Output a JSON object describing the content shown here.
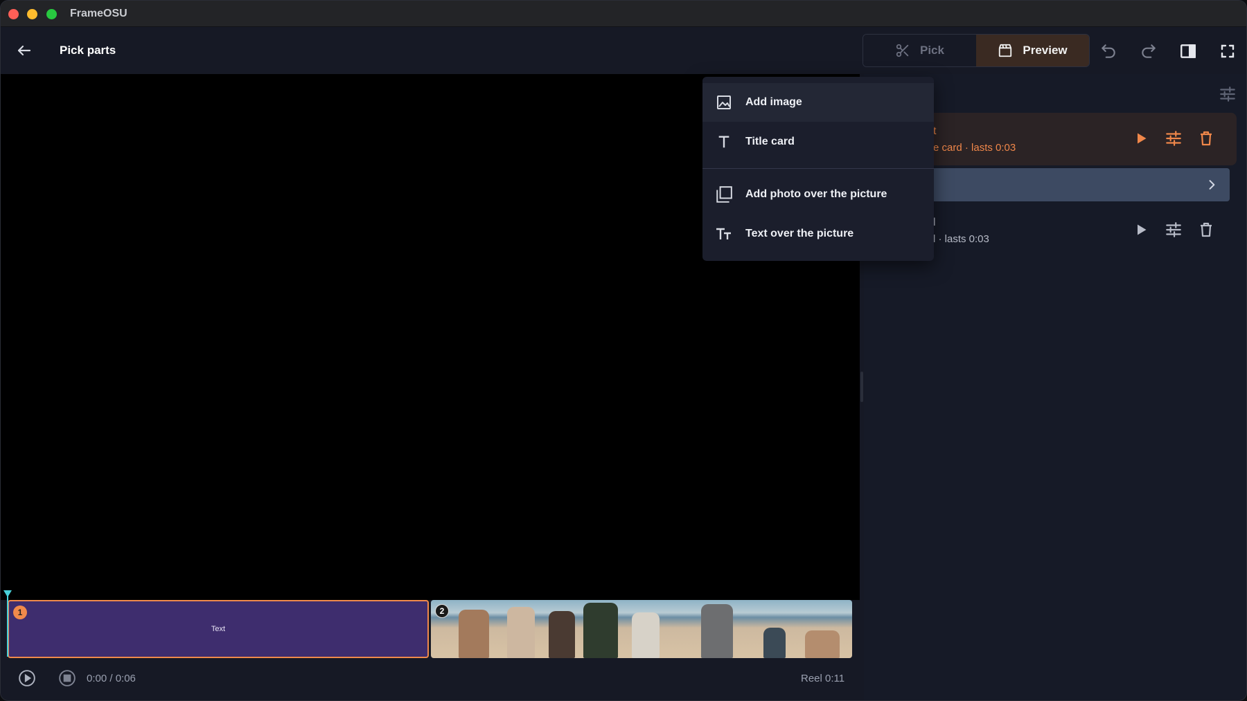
{
  "app": {
    "title": "FrameOSU"
  },
  "header": {
    "page_title": "Pick parts",
    "modes": {
      "pick": "Pick",
      "preview": "Preview"
    },
    "active_mode": "preview"
  },
  "menu": {
    "items": [
      {
        "label": "Add image",
        "icon": "image-icon"
      },
      {
        "label": "Title card",
        "icon": "text-t-icon"
      },
      {
        "label": "Add photo over the picture",
        "icon": "overlay-photo-icon"
      },
      {
        "label": "Text over the picture",
        "icon": "text-size-icon"
      }
    ]
  },
  "clips_panel": {
    "items": [
      {
        "name_visible": "t",
        "subtitle_visible": "e card · lasts 0:03",
        "active": true
      },
      {
        "name_visible": "l",
        "subtitle_visible": "l · lasts 0:03",
        "active": false
      }
    ]
  },
  "timeline": {
    "clips": [
      {
        "index": "1",
        "label": "Text"
      },
      {
        "index": "2",
        "label": ""
      }
    ],
    "time": "0:00 / 0:06",
    "reel": "Reel 0:11"
  },
  "colors": {
    "accent": "#f08a4b",
    "title_card_clip": "#3e2d6e",
    "transition_bar": "#3d4a62",
    "playhead": "#49d1d9"
  }
}
